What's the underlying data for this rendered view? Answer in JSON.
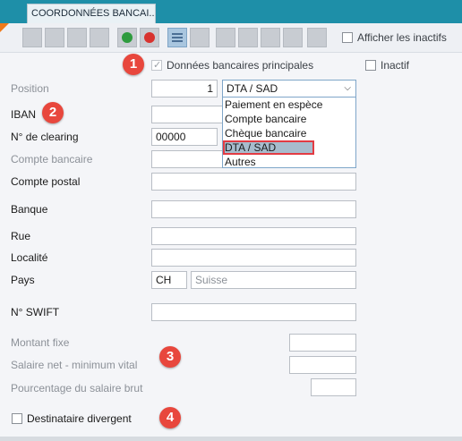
{
  "tab": {
    "label": "COORDONNÉES BANCAI..."
  },
  "toolbar": {
    "show_inactive_label": "Afficher les inactifs",
    "save_icon_color": "#2e9b3e",
    "cancel_icon_color": "#d8332f"
  },
  "form": {
    "main_bank_label": "Données bancaires principales",
    "inactive_label": "Inactif",
    "position": {
      "label": "Position",
      "value": "1",
      "type_value": "DTA / SAD"
    },
    "type_options": [
      "Paiement en espèce",
      "Compte bancaire",
      "Chèque bancaire",
      "DTA / SAD",
      "Autres"
    ],
    "iban": {
      "label": "IBAN",
      "value": ""
    },
    "clearing": {
      "label": "N° de clearing",
      "value": "00000"
    },
    "bank_account": {
      "label": "Compte bancaire",
      "value": ""
    },
    "postal_account": {
      "label": "Compte postal",
      "value": ""
    },
    "bank": {
      "label": "Banque",
      "value": ""
    },
    "street": {
      "label": "Rue",
      "value": ""
    },
    "locality": {
      "label": "Localité",
      "value": ""
    },
    "country": {
      "label": "Pays",
      "code": "CH",
      "name": "Suisse"
    },
    "swift": {
      "label": "N° SWIFT",
      "value": ""
    },
    "fixed_amount": {
      "label": "Montant fixe",
      "value": ""
    },
    "net_salary_min": {
      "label": "Salaire net - minimum vital",
      "value": ""
    },
    "gross_pct": {
      "label": "Pourcentage du salaire brut",
      "value": ""
    },
    "different_recipient_label": "Destinataire divergent"
  },
  "badges": [
    "1",
    "2",
    "3",
    "4"
  ],
  "colors": {
    "header": "#1e8fa8",
    "badge": "#e8473d",
    "selected_option": "#a7bccd"
  }
}
